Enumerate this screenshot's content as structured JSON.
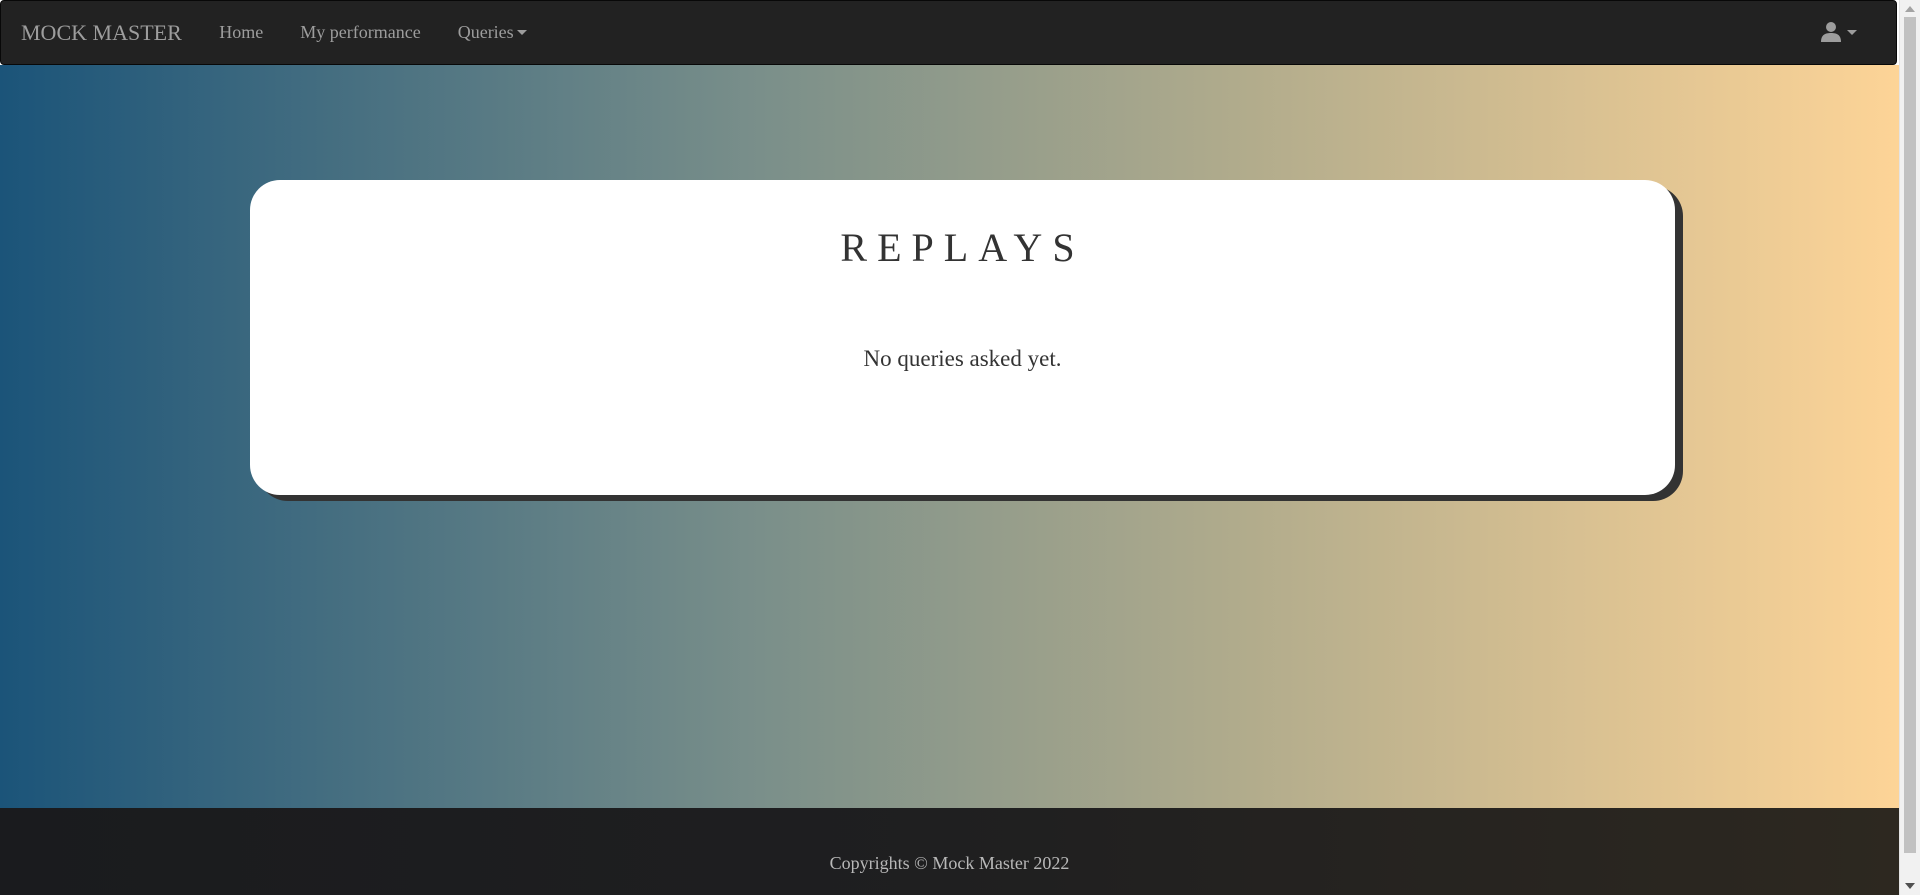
{
  "navbar": {
    "brand": "MOCK MASTER",
    "links": [
      {
        "label": "Home"
      },
      {
        "label": "My performance"
      },
      {
        "label": "Queries"
      }
    ],
    "user_icon": "user-icon"
  },
  "card": {
    "title": "REPLAYS",
    "message": "No queries asked yet."
  },
  "footer": {
    "text": "Copyrights © Mock Master 2022"
  },
  "colors": {
    "navbar_bg": "#222222",
    "gradient_start": "#1b5479",
    "gradient_end": "#fdd497",
    "card_bg": "#ffffff",
    "footer_bg": "#1f1f20"
  }
}
